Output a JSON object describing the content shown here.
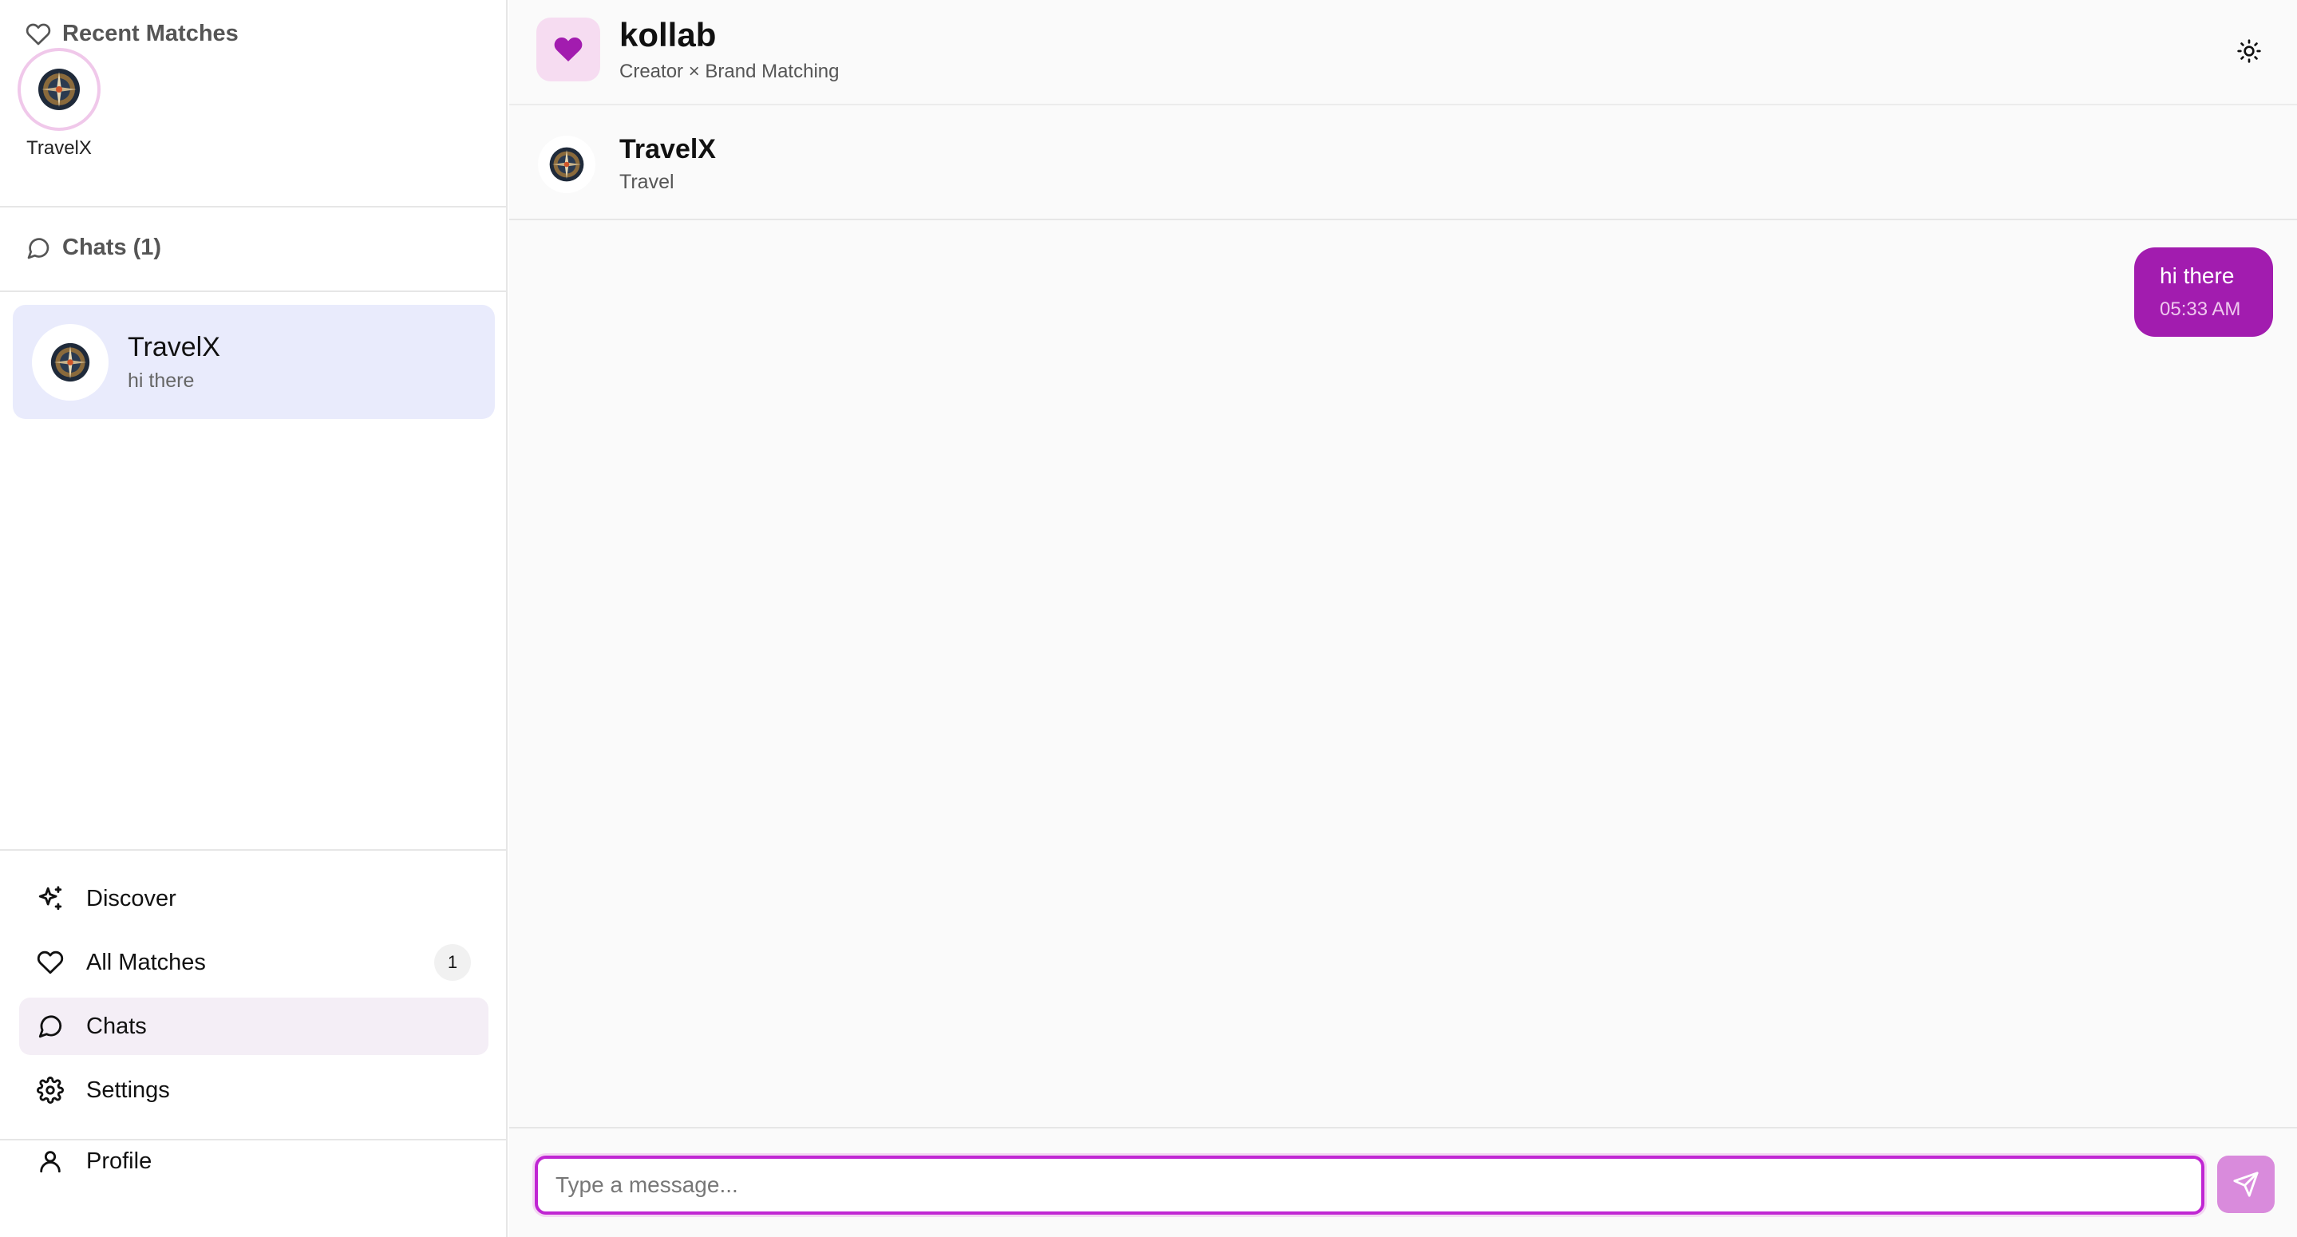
{
  "app": {
    "title": "kollab",
    "subtitle": "Creator × Brand Matching",
    "accent": "#a21caf"
  },
  "sidebar": {
    "recent_matches": {
      "title": "Recent Matches",
      "items": [
        {
          "name": "TravelX",
          "avatar_icon": "compass-logo-icon"
        }
      ]
    },
    "chats": {
      "title": "Chats (1)",
      "items": [
        {
          "name": "TravelX",
          "preview": "hi there",
          "avatar_icon": "compass-logo-icon"
        }
      ]
    },
    "nav": [
      {
        "label": "Discover",
        "icon": "sparkles-icon"
      },
      {
        "label": "All Matches",
        "icon": "heart-icon",
        "badge": "1"
      },
      {
        "label": "Chats",
        "icon": "message-circle-icon",
        "active": true
      },
      {
        "label": "Settings",
        "icon": "gear-icon"
      }
    ],
    "profile": {
      "label": "Profile",
      "icon": "user-icon"
    }
  },
  "conversation": {
    "name": "TravelX",
    "category": "Travel",
    "messages": [
      {
        "text": "hi there",
        "time": "05:33 AM",
        "outgoing": true
      }
    ]
  },
  "composer": {
    "placeholder": "Type a message...",
    "value": ""
  }
}
